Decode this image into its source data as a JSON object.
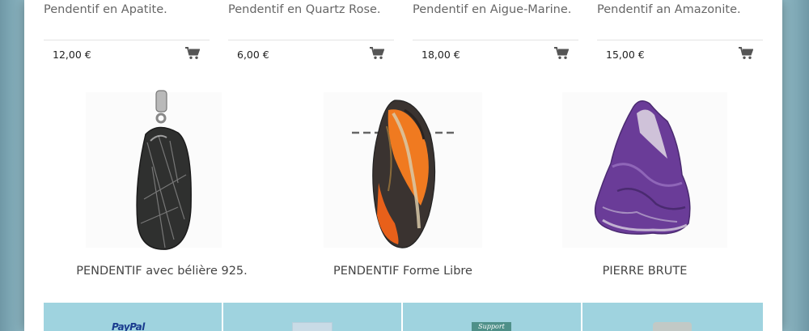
{
  "colors": {
    "accent": "#9fd3df",
    "page_bg": "#8fb9c5",
    "text": "#444444"
  },
  "products_top": [
    {
      "name": "Pendentif en Apatite.",
      "price": "12,00 €",
      "icon": "cart-icon"
    },
    {
      "name": "Pendentif en Quartz Rose.",
      "price": "6,00 €",
      "icon": "cart-icon"
    },
    {
      "name": "Pendentif en Aigue-Marine.",
      "price": "18,00 €",
      "icon": "cart-icon"
    },
    {
      "name": "Pendentif an Amazonite.",
      "price": "15,00 €",
      "icon": "cart-icon"
    }
  ],
  "categories": [
    {
      "title": "PENDENTIF avec bélière 925."
    },
    {
      "title": "PENDENTIF Forme Libre"
    },
    {
      "title": "PIERRE BRUTE"
    }
  ],
  "footer_logos": [
    {
      "text": "PayPal"
    },
    {
      "icon": "video-icon"
    },
    {
      "text": "Support"
    },
    {
      "icon": "badge-icon"
    }
  ]
}
